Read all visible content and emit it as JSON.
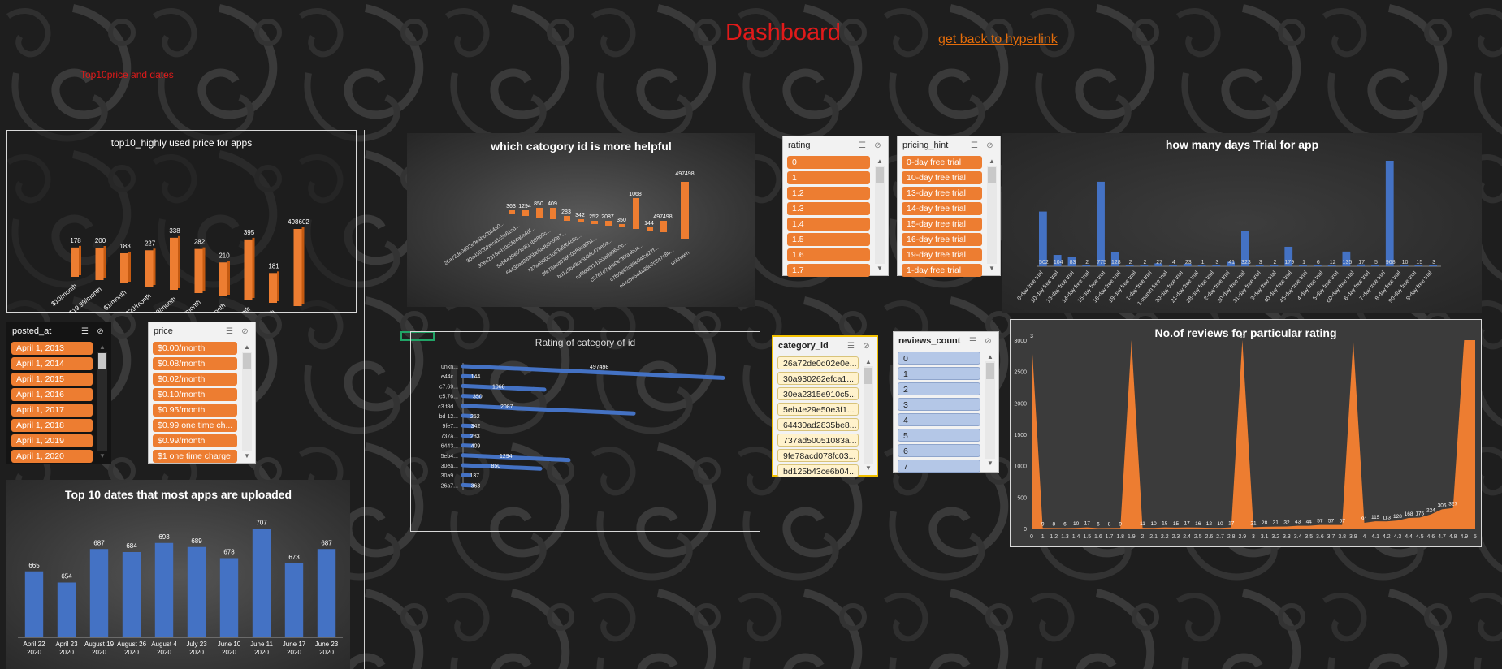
{
  "header": {
    "title": "Dashboard",
    "link": "get back to hyperlink",
    "subtitle": "Top10price and dates"
  },
  "colors": {
    "accent": "#ed7d31",
    "blue": "#4472c4",
    "title_red": "#e01a1a"
  },
  "chart_data": [
    {
      "id": "price",
      "type": "bar",
      "title": "top10_highly used price for apps",
      "categories": [
        "$10/month",
        "$19.99/month",
        "$1/month",
        "$29/month",
        "$4.99/month",
        "$49/month",
        "$5/month",
        "$9.99/month",
        "$9/month",
        "Free"
      ],
      "values": [
        178,
        200,
        183,
        227,
        338,
        282,
        210,
        395,
        181,
        498602
      ],
      "value_labels": [
        "178",
        "200",
        "183",
        "227",
        "338",
        "282",
        "210",
        "395",
        "181",
        "498602"
      ]
    },
    {
      "id": "category",
      "type": "bar",
      "title": "which catogory id is more helpful",
      "categories": [
        "26a72de0d02e0e5bb2b14a0... ",
        "30a930262efca1c5c61cd...",
        "30ea2315e910c5fe4a0c4df...",
        "5eb4e29e50e3f14b88b3c...",
        "64430ad2835be8ad60c59e7...",
        "737ad50051083a5f64c8c...",
        "9fe78acd078fc0389ea0b1...",
        "bd125b43ce6b04c47be6a...",
        "c3f8d00f1d1b3b0a96c0c...",
        "c5761e7a8b0e2f6fa4b0a...",
        "c7f69e92c99e04fcd27f...",
        "e44c5e5a4a38e2c3a7c8b...",
        "unknown"
      ],
      "values": [
        363,
        1294,
        850,
        409,
        283,
        342,
        252,
        2087,
        350,
        1068,
        144,
        497498,
        497498
      ],
      "value_labels": [
        "363",
        "1294",
        "850",
        "409",
        "283",
        "342",
        "252",
        "2087",
        "350",
        "1068",
        "144",
        "497498"
      ]
    },
    {
      "id": "trial",
      "type": "bar",
      "title": "how many days Trial for app",
      "categories": [
        "0-day free trial",
        "10-day free trial",
        "13-day free trial",
        "14-day free trial",
        "15-day free trial",
        "16-day free trial",
        "19-day free trial",
        "1-day free trial",
        "1-month free trial",
        "20-day free trial",
        "21-day free trial",
        "28-day free trial",
        "2-day free trial",
        "30-day free trial",
        "31-day free trial",
        "3-day free trial",
        "40-day free trial",
        "45-day free trial",
        "4-day free trial",
        "5-day free trial",
        "60-day free trial",
        "6-day free trial",
        "7-day free trial",
        "8-day free trial",
        "90-day free trial",
        "9-day free trial"
      ],
      "values": [
        502,
        104,
        83,
        2,
        775,
        128,
        2,
        2,
        27,
        4,
        23,
        1,
        3,
        41,
        323,
        3,
        2,
        179,
        1,
        6,
        12,
        135,
        17,
        5,
        968,
        10,
        15,
        3
      ],
      "value_labels": [
        "502",
        "104",
        "83",
        "2",
        "775",
        "128",
        "2",
        "2",
        "27",
        "4",
        "23",
        "1",
        "3",
        "41",
        "323",
        "3",
        "2",
        "179",
        "1",
        "6",
        "12",
        "135",
        "17",
        "5",
        "968",
        "10",
        "15",
        "3"
      ]
    },
    {
      "id": "dates",
      "type": "bar",
      "title": "Top 10 dates that most apps are uploaded",
      "categories": [
        "April 22, 2020",
        "April 23, 2020",
        "August 19, 2020",
        "August 26, 2020",
        "August 4, 2020",
        "July 23, 2020",
        "June 10, 2020",
        "June 11, 2020",
        "June 17, 2020",
        "June 23, 2020"
      ],
      "values": [
        665,
        654,
        687,
        684,
        693,
        689,
        678,
        707,
        673,
        687
      ]
    },
    {
      "id": "rating_cat",
      "type": "bar",
      "title": "Rating of category of id",
      "categories": [
        "unkn...",
        "e44c...",
        "c7.69...",
        "c5.76...",
        "c3.f8d...",
        "bd 12...",
        "9fe7...",
        "737a...",
        "6443...",
        "5eb4...",
        "30ea...",
        "30a9...",
        "26a7..."
      ],
      "values": [
        497498,
        144,
        1068,
        350,
        2087,
        252,
        342,
        283,
        409,
        1294,
        850,
        137,
        363
      ]
    },
    {
      "id": "reviews",
      "type": "area",
      "title": "No.of reviews for particular rating",
      "categories": [
        "0",
        "1",
        "1.2",
        "1.3",
        "1.4",
        "1.5",
        "1.6",
        "1.7",
        "1.8",
        "1.9",
        "2",
        "2.1",
        "2.2",
        "2.3",
        "2.4",
        "2.5",
        "2.6",
        "2.7",
        "2.8",
        "2.9",
        "3",
        "3.1",
        "3.2",
        "3.3",
        "3.4",
        "3.5",
        "3.6",
        "3.7",
        "3.8",
        "3.9",
        "4",
        "4.1",
        "4.2",
        "4.3",
        "4.4",
        "4.5",
        "4.6",
        "4.7",
        "4.8",
        "4.9",
        "5"
      ],
      "values": [
        3000,
        9,
        8,
        6,
        10,
        17,
        6,
        8,
        9,
        3000,
        11,
        10,
        18,
        15,
        17,
        16,
        12,
        10,
        17,
        3000,
        21,
        28,
        31,
        32,
        43,
        44,
        57,
        57,
        57,
        3000,
        91,
        115,
        113,
        128,
        168,
        175,
        224,
        306,
        327,
        3000,
        3000
      ],
      "value_labels": [
        "3",
        "9",
        "8",
        "6",
        "10",
        "17",
        "6",
        "8",
        "9",
        "",
        "11",
        "10",
        "18",
        "15",
        "17",
        "16",
        "12",
        "10",
        "17",
        "31",
        "21",
        "28",
        "31",
        "32",
        "43",
        "44",
        "57",
        "57",
        "57",
        "",
        "91",
        "115",
        "113",
        "128",
        "168",
        "175",
        "224",
        "306",
        "327",
        "",
        ""
      ],
      "yticks": [
        "0",
        "500",
        "1000",
        "1500",
        "2000",
        "2500",
        "3000"
      ]
    }
  ],
  "slicers": {
    "rating": {
      "header": "rating",
      "items": [
        "0",
        "1",
        "1.2",
        "1.3",
        "1.4",
        "1.5",
        "1.6",
        "1.7"
      ]
    },
    "pricing_hint": {
      "header": "pricing_hint",
      "items": [
        "0-day free trial",
        "10-day free trial",
        "13-day free trial",
        "14-day free trial",
        "15-day free trial",
        "16-day free trial",
        "19-day free trial",
        "1-day free trial"
      ]
    },
    "posted_at": {
      "header": "posted_at",
      "items": [
        "April 1, 2013",
        "April 1, 2014",
        "April 1, 2015",
        "April 1, 2016",
        "April 1, 2017",
        "April 1, 2018",
        "April 1, 2019",
        "April 1, 2020"
      ]
    },
    "price": {
      "header": "price",
      "items": [
        "$0.00/month",
        "$0.08/month",
        "$0.02/month",
        "$0.10/month",
        "$0.95/month",
        "$0.99 one time ch...",
        "$0.99/month",
        "$1 one time charge"
      ]
    },
    "category_id": {
      "header": "category_id",
      "items": [
        "26a72de0d02e0e...",
        "30a930262efca1...",
        "30ea2315e910c5...",
        "5eb4e29e50e3f1...",
        "64430ad2835be8...",
        "737ad50051083a...",
        "9fe78acd078fc03...",
        "bd125b43ce6b04..."
      ]
    },
    "reviews_count": {
      "header": "reviews_count",
      "items": [
        "0",
        "1",
        "2",
        "3",
        "4",
        "5",
        "6",
        "7"
      ]
    }
  }
}
